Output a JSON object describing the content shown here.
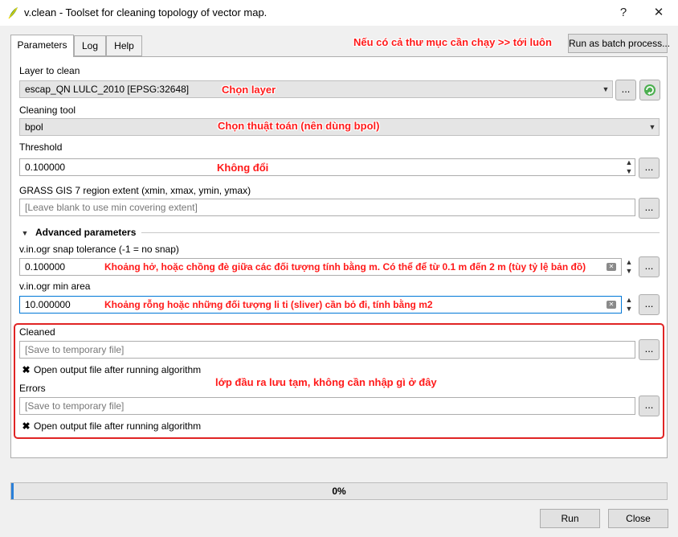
{
  "window": {
    "title": "v.clean - Toolset for cleaning topology of vector map.",
    "help_button": "?",
    "close_button": "✕"
  },
  "tabs": [
    {
      "label": "Parameters",
      "active": true
    },
    {
      "label": "Log",
      "active": false
    },
    {
      "label": "Help",
      "active": false
    }
  ],
  "batch_button": "Run as batch process...",
  "params": {
    "layer": {
      "label": "Layer to clean",
      "value": "escap_QN LULC_2010 [EPSG:32648]"
    },
    "tool": {
      "label": "Cleaning tool",
      "value": "bpol"
    },
    "threshold": {
      "label": "Threshold",
      "value": "0.100000"
    },
    "region": {
      "label": "GRASS GIS 7 region extent (xmin, xmax, ymin, ymax)",
      "placeholder": "[Leave blank to use min covering extent]"
    },
    "advanced_header": "Advanced parameters",
    "snap": {
      "label": "v.in.ogr snap tolerance (-1 = no snap)",
      "value": "0.100000"
    },
    "min_area": {
      "label": "v.in.ogr min area",
      "value": "10.000000"
    },
    "cleaned": {
      "label": "Cleaned",
      "placeholder": "[Save to temporary file]",
      "checkbox_label": "Open output file after running algorithm"
    },
    "errors": {
      "label": "Errors",
      "placeholder": "[Save to temporary file]",
      "checkbox_label": "Open output file after running algorithm"
    }
  },
  "ellipsis": "...",
  "annotations": {
    "batch": "Nếu có cả thư mục cần chạy >> tới luôn",
    "layer": "Chọn layer",
    "tool": "Chọn thuật toán (nên dùng bpol)",
    "threshold": "Không đổi",
    "snap": "Khoảng hở, hoặc chồng đè giữa các đối tượng tính bằng m. Có thể để từ 0.1 m đến 2 m (tùy tỷ lệ bản đồ)",
    "min_area": "Khoảng rỗng hoặc những đối tượng li ti (sliver) cần bỏ đi, tính bằng m2",
    "output": "lớp đầu ra lưu tạm, không cần nhập gì ở đây"
  },
  "progress": {
    "text": "0%",
    "fraction": 0.0
  },
  "buttons": {
    "run": "Run",
    "close": "Close"
  },
  "colors": {
    "annotation": "#ff1a1a",
    "highlight_box": "#e02424",
    "progress": "#06b025"
  }
}
